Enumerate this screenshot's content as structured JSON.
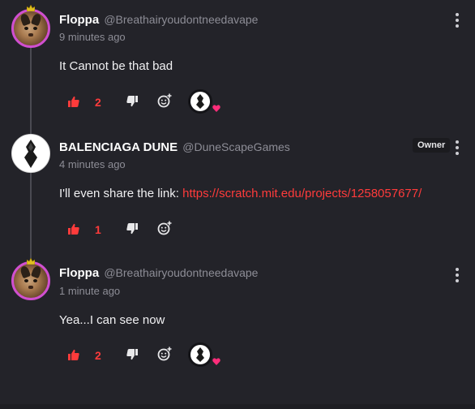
{
  "colors": {
    "background": "#232329",
    "accent_red": "#ff3b3b",
    "handle_gray": "#8d8d96",
    "avatar_ring": "#d04fd0",
    "heart_pink": "#ff2d7a"
  },
  "comments": [
    {
      "author": "Floppa",
      "handle": "@Breathairyoudontneedavape",
      "time": "9 minutes ago",
      "text": "It Cannot be that bad",
      "likes": "2",
      "has_reaction": true
    },
    {
      "author": "BALENCIAGA DUNE",
      "handle": "@DuneScapeGames",
      "badge": "Owner",
      "time": "4 minutes ago",
      "text": "I'll even share the link: ",
      "link": "https://scratch.mit.edu/projects/1258057677/",
      "likes": "1",
      "has_reaction": false
    },
    {
      "author": "Floppa",
      "handle": "@Breathairyoudontneedavape",
      "time": "1 minute ago",
      "text": "Yea...I can see now",
      "likes": "2",
      "has_reaction": true
    }
  ],
  "icons": {
    "like": "thumbs-up-icon",
    "dislike": "thumbs-down-icon",
    "react": "add-reaction-icon",
    "menu": "more-vertical-icon",
    "heart": "heart-icon",
    "crown": "crown-icon"
  }
}
